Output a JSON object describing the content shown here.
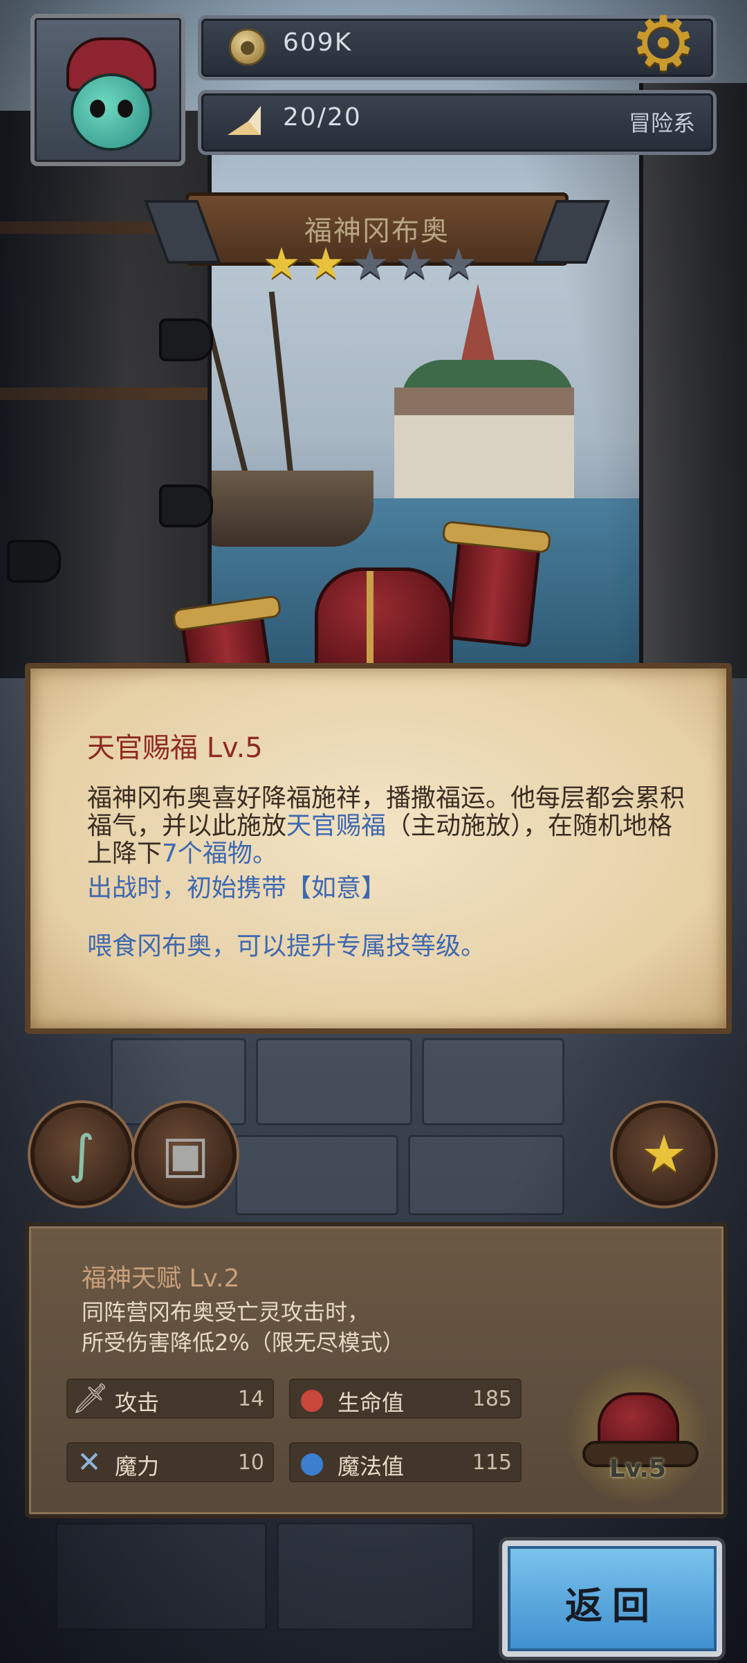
{
  "hud": {
    "coins": "609K",
    "energy": "20/20",
    "category": "冒险系",
    "coin_icon": "coin-icon",
    "energy_icon": "cake-slice-icon",
    "settings_icon": "gear-icon"
  },
  "character": {
    "name": "福神冈布奥",
    "stars_filled": 2,
    "stars_total": 5
  },
  "skill": {
    "title": "天官赐福 Lv.5",
    "desc_part1": "福神冈布奥喜好降福施祥，播撒福运。他每层都会累积福气，并以此施放",
    "desc_link": "天官赐福",
    "desc_part2": "（主动施放），在随机地格上降下",
    "desc_num": "7",
    "desc_part3": "个福物。",
    "line_battle": "出战时，初始携带【如意】",
    "line_feed": "喂食冈布奥，可以提升专属技等级。"
  },
  "talent": {
    "title": "福神天赋 Lv.2",
    "desc_line1": "同阵营冈布奥受亡灵攻击时，",
    "desc_line2": "所受伤害降低2%（限无尽模式）",
    "stats": {
      "attack": {
        "label": "攻击",
        "value": "14"
      },
      "hp": {
        "label": "生命值",
        "value": "185"
      },
      "magic": {
        "label": "魔力",
        "value": "10"
      },
      "mp": {
        "label": "魔法值",
        "value": "115"
      }
    },
    "emblem_level": "Lv.5"
  },
  "buttons": {
    "back": "返回"
  },
  "colors": {
    "skill_title": "#8e2a22",
    "highlight_text": "#3f68b0",
    "star_on": "#e8c23a",
    "back_button": "#3f8fd0"
  }
}
